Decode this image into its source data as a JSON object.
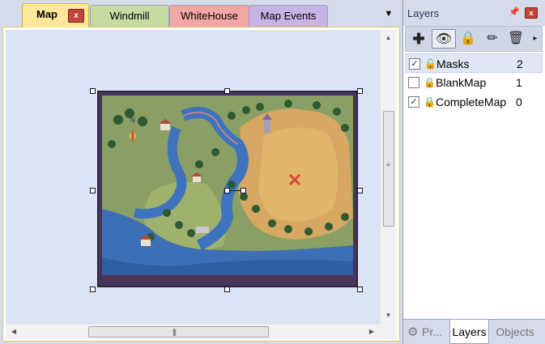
{
  "tabs": [
    {
      "label": "Map",
      "color": "#ffe79a",
      "active": true
    },
    {
      "label": "Windmill",
      "color": "#c5dba2"
    },
    {
      "label": "WhiteHouse",
      "color": "#f2a7a4"
    },
    {
      "label": "Map Events",
      "color": "#c8b3e6"
    }
  ],
  "tab_close_glyph": "x",
  "tab_dropdown_glyph": "▼",
  "panel": {
    "title": "Layers",
    "pin_glyph": "📌",
    "close_glyph": "x",
    "toolbar": {
      "add_glyph": "✚",
      "visibility_glyph": "👁",
      "lock_glyph": "🔒",
      "edit_glyph": "✏",
      "delete_glyph": "🗑",
      "more_glyph": "▸"
    },
    "layers": [
      {
        "name": "Masks",
        "count": "2",
        "checked": true,
        "locked": false,
        "selected": true
      },
      {
        "name": "BlankMap",
        "count": "1",
        "checked": false,
        "locked": true,
        "selected": false
      },
      {
        "name": "CompleteMap",
        "count": "0",
        "checked": true,
        "locked": true,
        "selected": false
      }
    ],
    "bottom_tabs": [
      "Pr...",
      "Layers",
      "Objects"
    ]
  },
  "scroll": {
    "up": "▲",
    "down": "▼",
    "left": "◀",
    "right": "▶",
    "vgrip": "≡",
    "hgrip": "|||"
  }
}
